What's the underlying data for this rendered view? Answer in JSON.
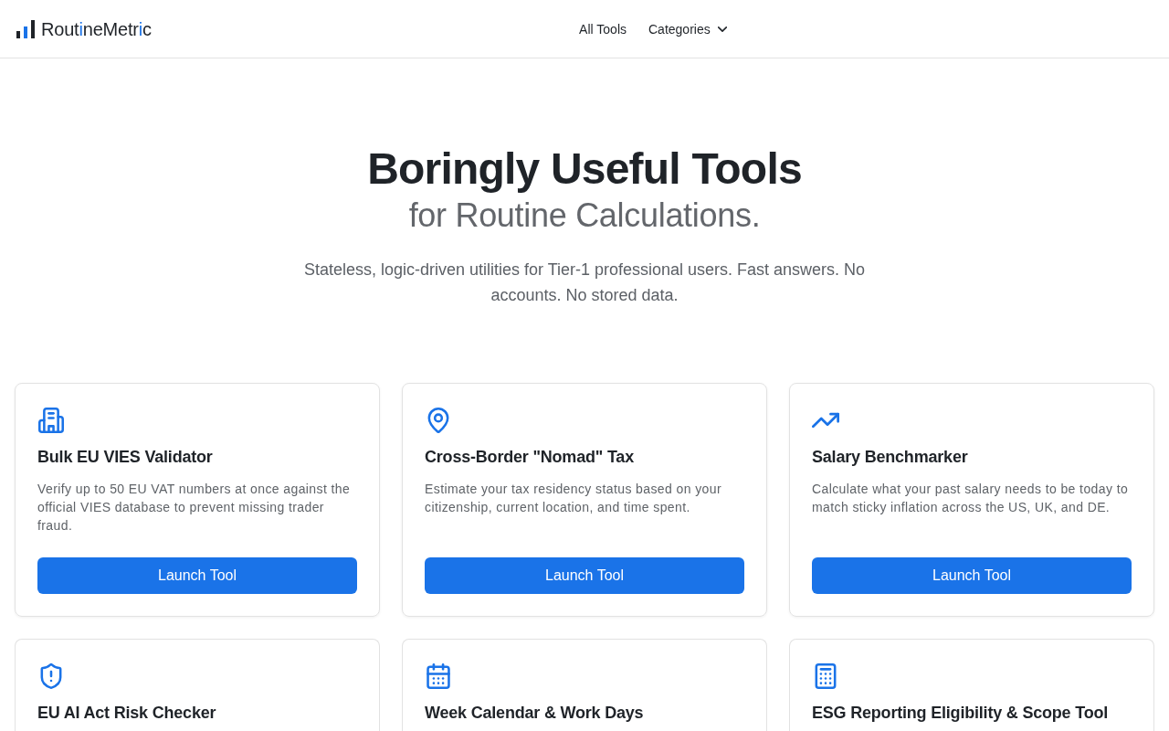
{
  "header": {
    "logo": {
      "segments": [
        {
          "text": "Rout",
          "accent": false
        },
        {
          "text": "i",
          "accent": true
        },
        {
          "text": "neMetr",
          "accent": false
        },
        {
          "text": "i",
          "accent": true
        },
        {
          "text": "c",
          "accent": false
        }
      ]
    },
    "nav": [
      {
        "label": "All Tools",
        "kind": "link"
      },
      {
        "label": "Categories",
        "kind": "dropdown"
      }
    ]
  },
  "hero": {
    "title": "Boringly Useful Tools",
    "subtitle": "for Routine Calculations.",
    "description": "Stateless, logic-driven utilities for Tier-1 professional users. Fast answers. No accounts. No stored data."
  },
  "tools": [
    {
      "title": "Bulk EU VIES Validator",
      "description": "Verify up to 50 EU VAT numbers at once against the official VIES database to prevent missing trader fraud.",
      "button": "Launch Tool"
    },
    {
      "title": "Cross-Border \"Nomad\" Tax",
      "description": "Estimate your tax residency status based on your citizenship, current location, and time spent.",
      "button": "Launch Tool"
    },
    {
      "title": "Salary Benchmarker",
      "description": "Calculate what your past salary needs to be today to match sticky inflation across the US, UK, and DE.",
      "button": "Launch Tool"
    },
    {
      "title": "EU AI Act Risk Checker"
    },
    {
      "title": "Week Calendar & Work Days"
    },
    {
      "title": "ESG Reporting Eligibility & Scope Tool"
    }
  ]
}
